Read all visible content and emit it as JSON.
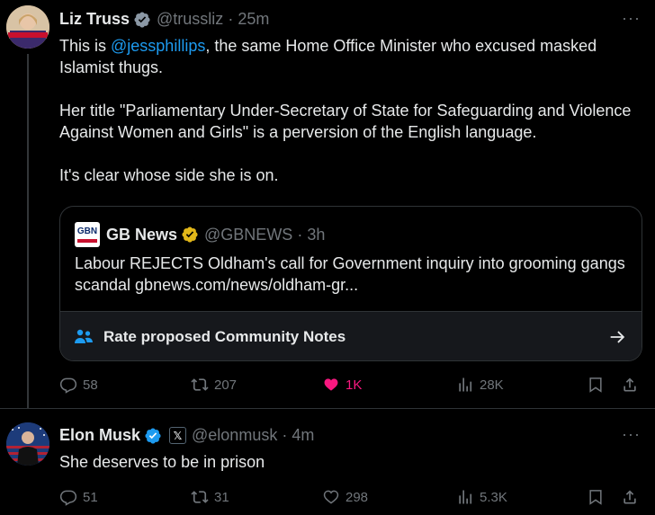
{
  "tweets": [
    {
      "author_name": "Liz Truss",
      "handle": "@trussliz",
      "separator": "·",
      "time": "25m",
      "more_label": "···",
      "body": {
        "p1_pre": "This is ",
        "p1_mention": "@jessphillips",
        "p1_post": ", the same Home Office Minister who excused masked Islamist thugs.",
        "p2": "Her title \"Parliamentary Under-Secretary of State for Safeguarding and Violence Against Women and Girls\" is a perversion of the English language.",
        "p3": "It's clear whose side she is on."
      },
      "quote": {
        "logo_text": "GBN",
        "author_name": "GB News",
        "handle": "@GBNEWS",
        "separator": "·",
        "time": "3h",
        "text": "Labour REJECTS Oldham's call for Government inquiry into grooming gangs scandal gbnews.com/news/oldham-gr...",
        "community_notes_label": "Rate proposed Community Notes"
      },
      "actions": {
        "replies": "58",
        "retweets": "207",
        "likes": "1K",
        "views": "28K"
      }
    },
    {
      "author_name": "Elon Musk",
      "affiliate_badge": "𝕏",
      "handle": "@elonmusk",
      "separator": "·",
      "time": "4m",
      "more_label": "···",
      "body": {
        "text": "She deserves to be in prison"
      },
      "actions": {
        "replies": "51",
        "retweets": "31",
        "likes": "298",
        "views": "5.3K"
      }
    }
  ],
  "colors": {
    "accent": "#1d9bf0",
    "like": "#f91880",
    "muted": "#71767b",
    "gold_badge": "#e2b719"
  },
  "icons": [
    "verified-badge-icon",
    "gold-verified-badge-icon",
    "reply-icon",
    "retweet-icon",
    "like-icon",
    "views-icon",
    "bookmark-icon",
    "share-icon",
    "community-notes-icon",
    "arrow-right-icon",
    "more-icon"
  ]
}
